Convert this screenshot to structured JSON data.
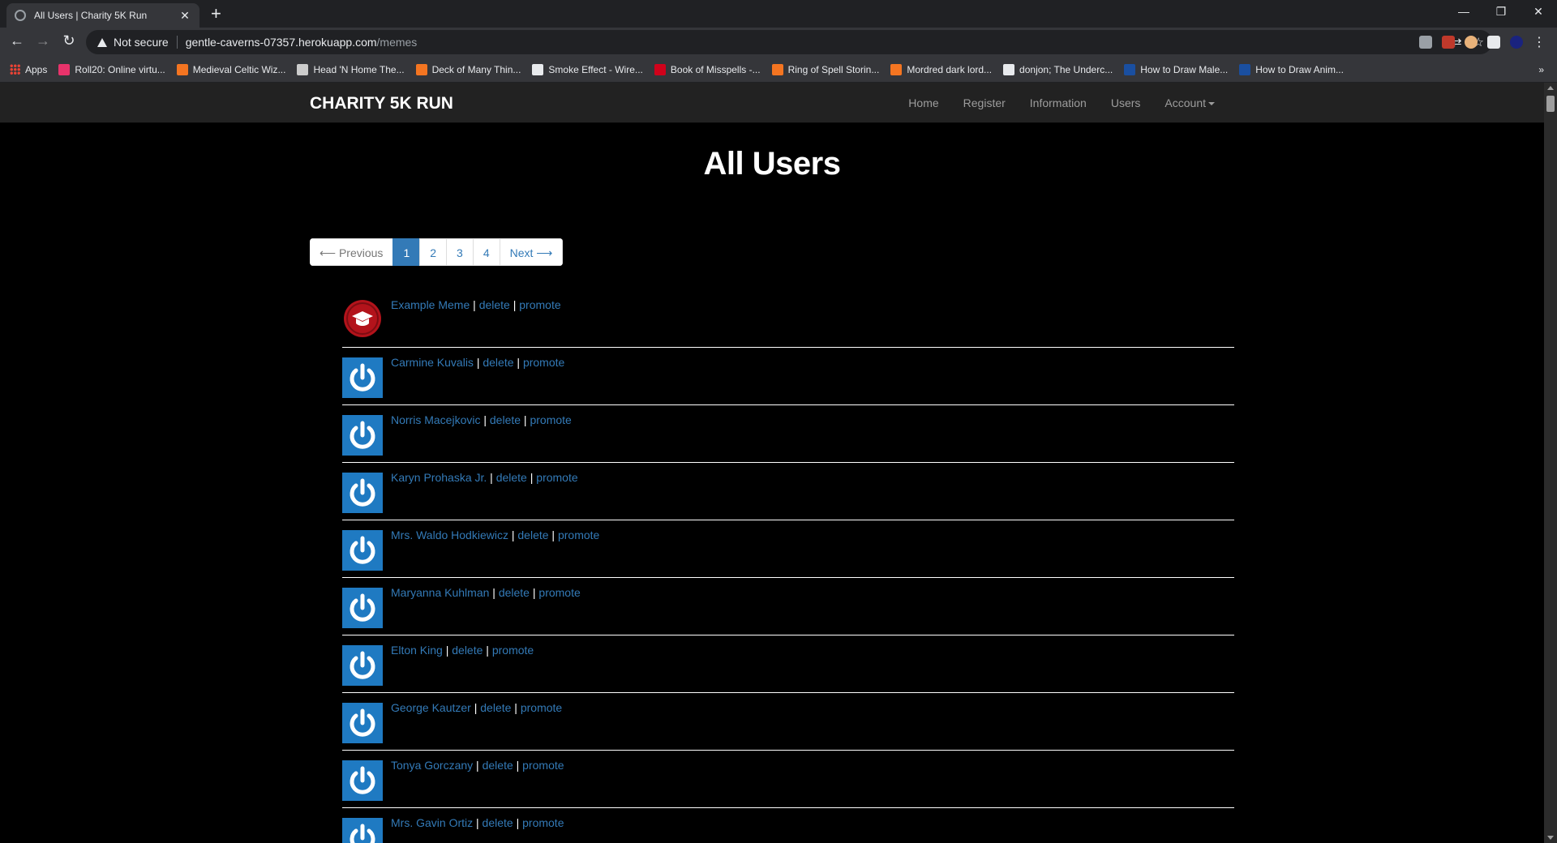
{
  "browser": {
    "tab_title": "All Users | Charity 5K Run",
    "tab_close": "✕",
    "new_tab": "+",
    "security_label": "Not secure",
    "url_host": "gentle-caverns-07357.herokuapp.com",
    "url_path": "/memes",
    "bookmarks": [
      {
        "label": "Apps",
        "color": "#ea4335"
      },
      {
        "label": "Roll20: Online virtu...",
        "color": "#e8336b"
      },
      {
        "label": "Medieval Celtic Wiz...",
        "color": "#f47521"
      },
      {
        "label": "Head 'N Home The...",
        "color": "#cccccc"
      },
      {
        "label": "Deck of Many Thin...",
        "color": "#f47521"
      },
      {
        "label": "Smoke Effect - Wire...",
        "color": "#e8eaed"
      },
      {
        "label": "Book of Misspells -...",
        "color": "#d0021b"
      },
      {
        "label": "Ring of Spell Storin...",
        "color": "#f47521"
      },
      {
        "label": "Mordred dark lord...",
        "color": "#f47521"
      },
      {
        "label": "donjon; The Underc...",
        "color": "#e8eaed"
      },
      {
        "label": "How to Draw Male...",
        "color": "#1a4fa0"
      },
      {
        "label": "How to Draw Anim...",
        "color": "#1a4fa0"
      }
    ],
    "bookmarks_more": "»"
  },
  "site": {
    "brand": "CHARITY 5K RUN",
    "nav": {
      "home": "Home",
      "register": "Register",
      "information": "Information",
      "users": "Users",
      "account": "Account"
    }
  },
  "page": {
    "title": "All Users",
    "pagination": {
      "previous": "⟵ Previous",
      "pages": [
        "1",
        "2",
        "3",
        "4"
      ],
      "active_page": "1",
      "next": "Next ⟶"
    },
    "separator": " | ",
    "delete_label": "delete",
    "promote_label": "promote",
    "users": [
      {
        "name": "Example Meme",
        "avatar": "graduation-cap"
      },
      {
        "name": "Carmine Kuvalis",
        "avatar": "power"
      },
      {
        "name": "Norris Macejkovic",
        "avatar": "power"
      },
      {
        "name": "Karyn Prohaska Jr.",
        "avatar": "power"
      },
      {
        "name": "Mrs. Waldo Hodkiewicz",
        "avatar": "power"
      },
      {
        "name": "Maryanna Kuhlman",
        "avatar": "power"
      },
      {
        "name": "Elton King",
        "avatar": "power"
      },
      {
        "name": "George Kautzer",
        "avatar": "power"
      },
      {
        "name": "Tonya Gorczany",
        "avatar": "power"
      },
      {
        "name": "Mrs. Gavin Ortiz",
        "avatar": "power"
      }
    ]
  }
}
